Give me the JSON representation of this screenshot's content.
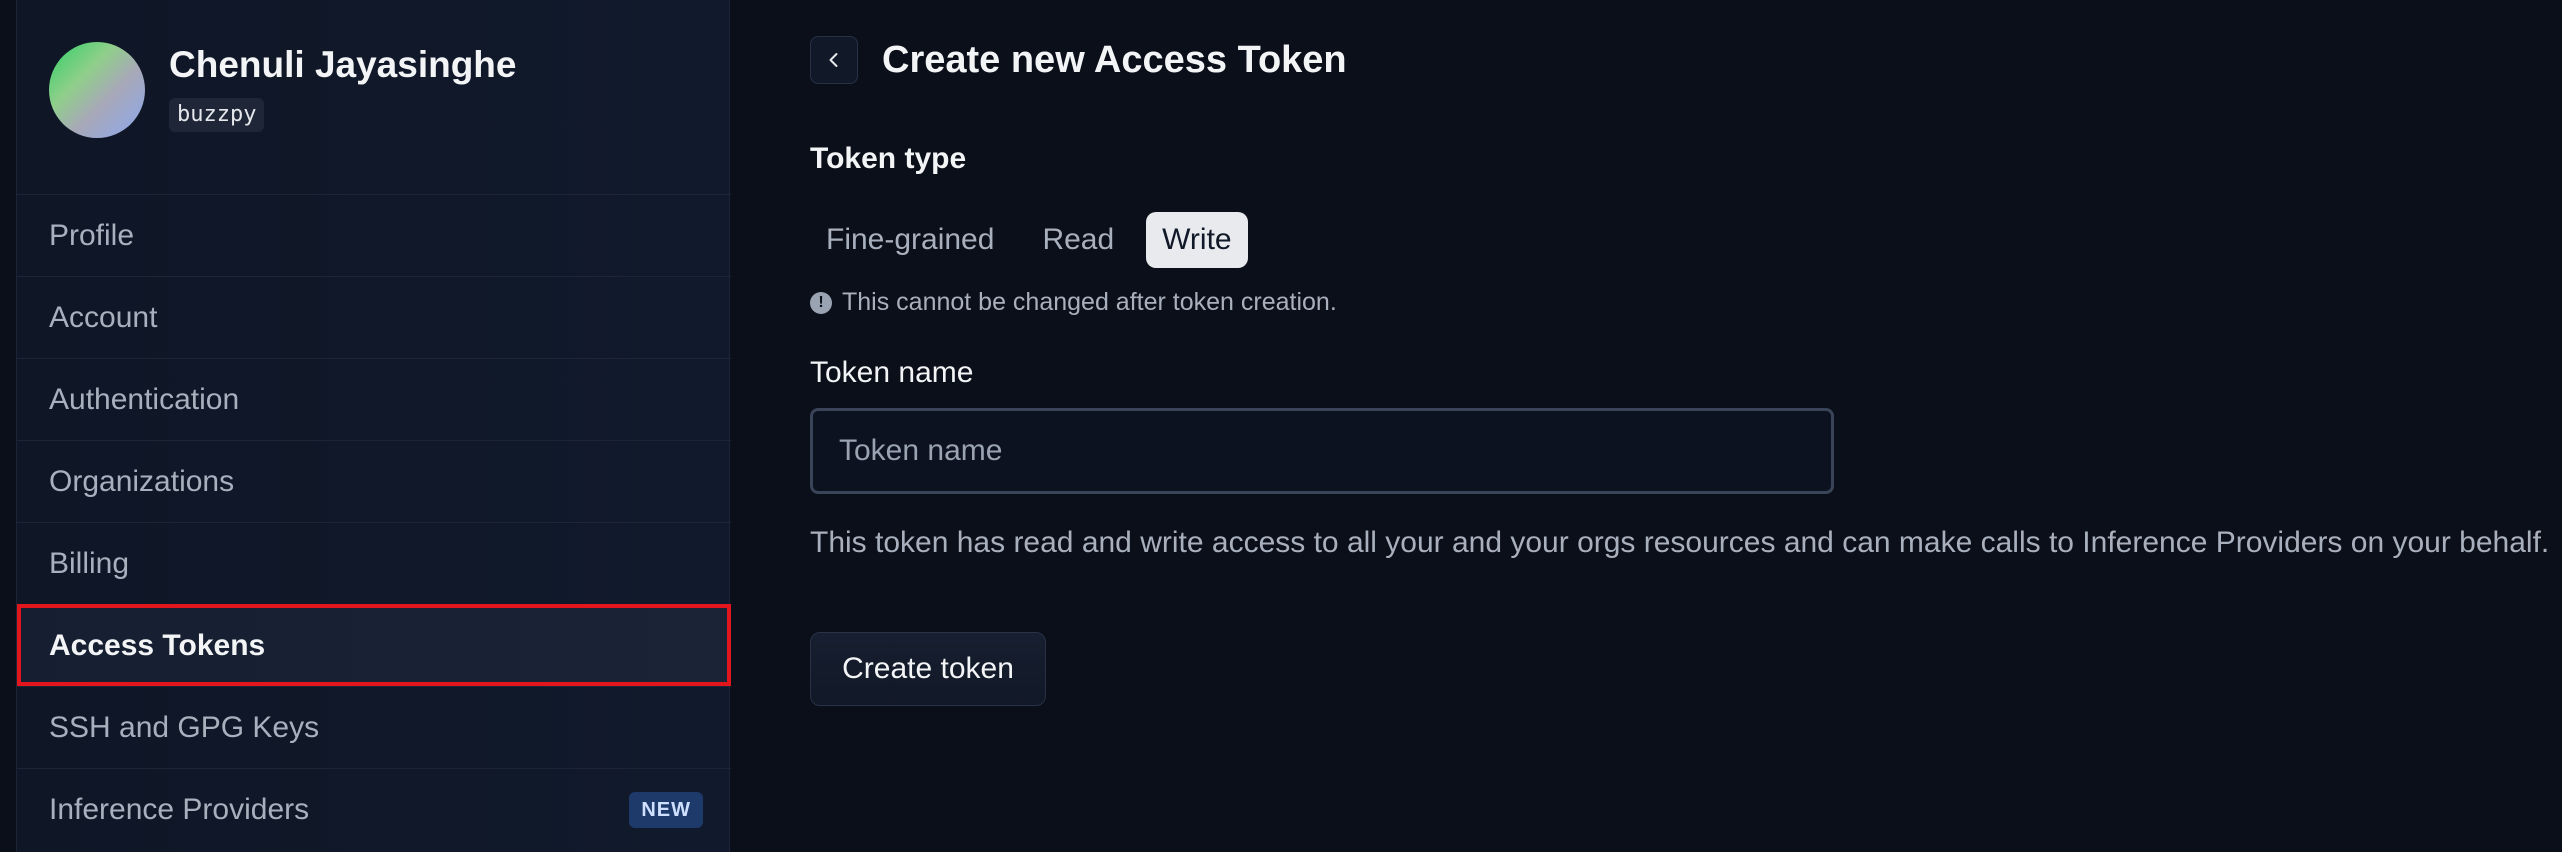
{
  "user": {
    "name": "Chenuli Jayasinghe",
    "handle": "buzzpy"
  },
  "sidebar": {
    "items": [
      {
        "label": "Profile",
        "active": false
      },
      {
        "label": "Account",
        "active": false
      },
      {
        "label": "Authentication",
        "active": false
      },
      {
        "label": "Organizations",
        "active": false
      },
      {
        "label": "Billing",
        "active": false
      },
      {
        "label": "Access Tokens",
        "active": true
      },
      {
        "label": "SSH and GPG Keys",
        "active": false
      },
      {
        "label": "Inference Providers",
        "active": false,
        "badge": "NEW"
      }
    ]
  },
  "main": {
    "title": "Create new Access Token",
    "back_icon": "chevron-left-icon",
    "token_type_label": "Token type",
    "token_types": [
      {
        "label": "Fine-grained",
        "selected": false
      },
      {
        "label": "Read",
        "selected": false
      },
      {
        "label": "Write",
        "selected": true
      }
    ],
    "hint_icon": "info-circle-icon",
    "hint_text": "This cannot be changed after token creation.",
    "token_name_label": "Token name",
    "token_name_placeholder": "Token name",
    "token_name_value": "",
    "description": "This token has read and write access to all your and your orgs resources and can make calls to Inference Providers on your behalf.",
    "create_button": "Create token"
  },
  "colors": {
    "background": "#0b0f19",
    "sidebar": "#111a2c",
    "highlight_outline": "#e3161e",
    "selected_pill": "#e8eaee",
    "badge_bg": "#1d3a6b"
  }
}
